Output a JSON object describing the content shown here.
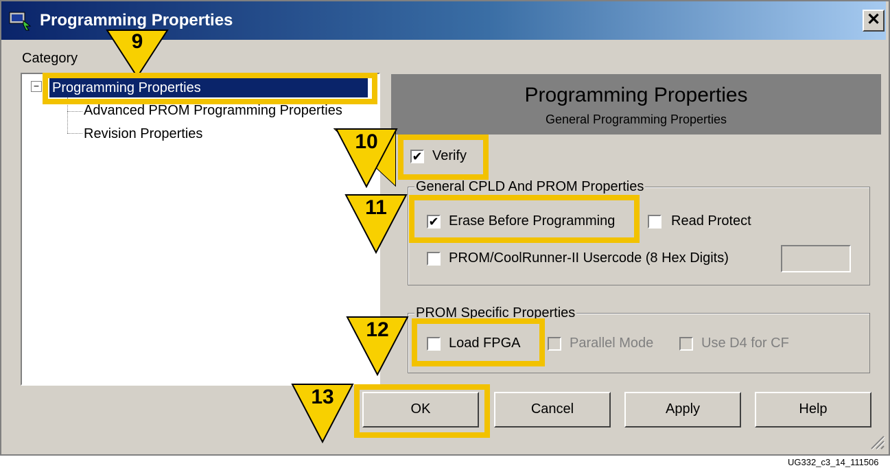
{
  "window": {
    "title": "Programming Properties",
    "close_label": "✕"
  },
  "category_label": "Category",
  "tree": {
    "expander": "−",
    "selected": "Programming Properties",
    "children": [
      "Advanced PROM Programming Properties",
      "Revision Properties"
    ]
  },
  "header": {
    "title": "Programming Properties",
    "subtitle": "General Programming Properties"
  },
  "verify": {
    "label": "Verify",
    "checked": "✔"
  },
  "group_general": {
    "legend": "General CPLD And PROM Properties",
    "erase_label": "Erase Before Programming",
    "erase_checked": "✔",
    "read_protect_label": "Read Protect",
    "usercode_label": "PROM/CoolRunner-II Usercode (8 Hex Digits)",
    "usercode_value": ""
  },
  "group_prom": {
    "legend": "PROM Specific Properties",
    "load_fpga_label": "Load FPGA",
    "parallel_label": "Parallel Mode",
    "d4_label": "Use D4 for CF"
  },
  "buttons": {
    "ok": "OK",
    "cancel": "Cancel",
    "apply": "Apply",
    "help": "Help"
  },
  "callouts": [
    "9",
    "10",
    "11",
    "12",
    "13"
  ],
  "footer": "UG332_c3_14_111506",
  "colors": {
    "callout": "#f2c200",
    "callout_fill": "#f8d000",
    "titlebar": "#0a246a",
    "dialog_bg": "#d4d0c8"
  }
}
